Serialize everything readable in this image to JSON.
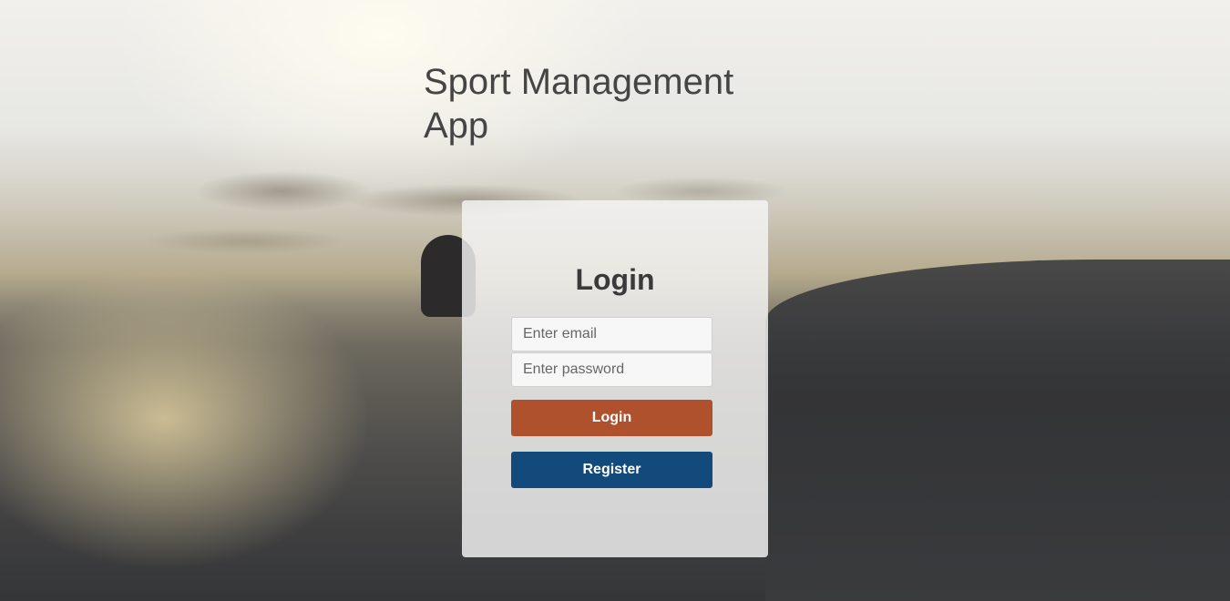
{
  "app": {
    "title": "Sport Management App"
  },
  "login_form": {
    "heading": "Login",
    "email_placeholder": "Enter email",
    "email_value": "",
    "password_placeholder": "Enter password",
    "password_value": "",
    "login_label": "Login",
    "register_label": "Register"
  },
  "colors": {
    "login_button": "#b0512e",
    "register_button": "#124a7c",
    "title_text": "#454545"
  }
}
